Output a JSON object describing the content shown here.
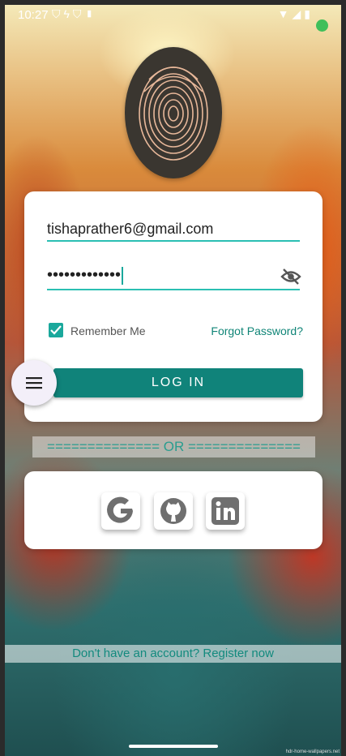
{
  "status_bar": {
    "time": "10:27",
    "left_icons": [
      "shield-icon",
      "bolt-icon",
      "shield-icon",
      "sd-card-icon"
    ],
    "right_icons": [
      "wifi-icon",
      "signal-icon",
      "battery-icon"
    ],
    "dot_color": "#3fbf5a"
  },
  "login": {
    "email_value": "tishaprather6@gmail.com",
    "password_masked": "•••••••••••••",
    "remember_label": "Remember Me",
    "remember_checked": true,
    "forgot_label": "Forgot Password?",
    "login_label": "LOG IN"
  },
  "divider": {
    "text": "============== OR =============="
  },
  "social": {
    "buttons": [
      "google-icon",
      "github-icon",
      "linkedin-icon"
    ]
  },
  "register": {
    "text": "Don't have an account? Register now"
  },
  "watermark": {
    "text": "hdr-home-wallpapers.net"
  },
  "colors": {
    "accent": "#10837a",
    "field_underline": "#2bbfb3",
    "link": "#108577"
  }
}
